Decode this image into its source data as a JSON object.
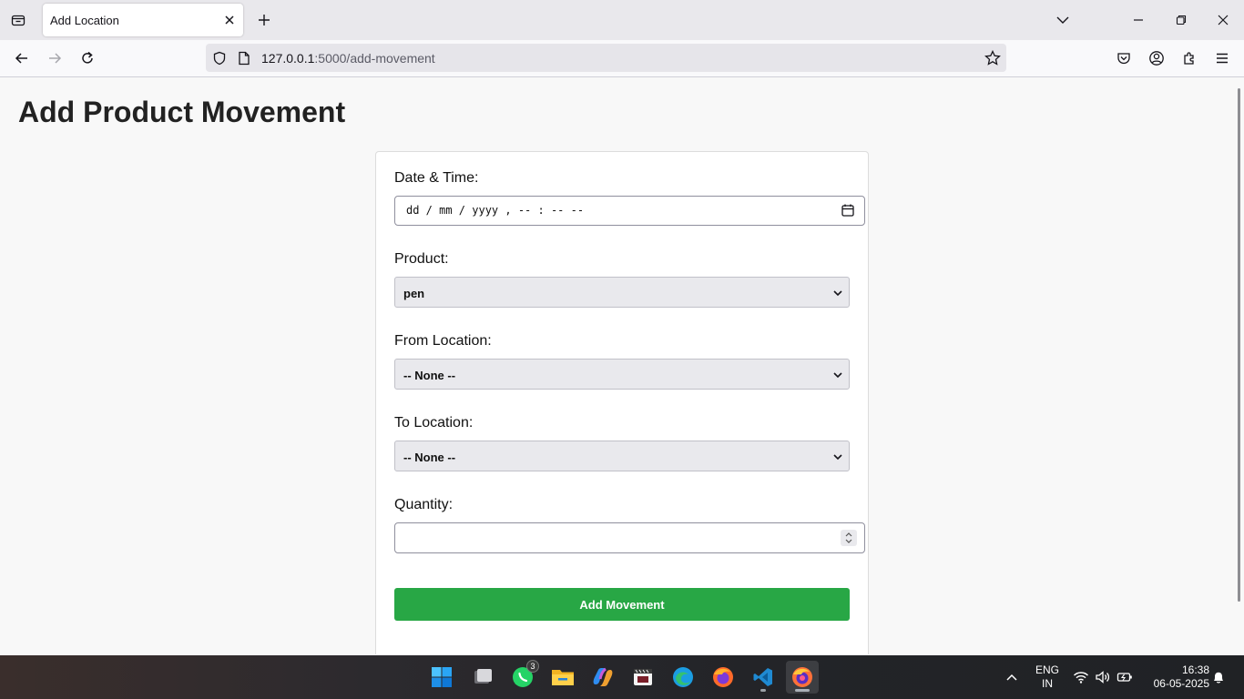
{
  "browser": {
    "tab_title": "Add Location",
    "url_host": "127.0.0.1",
    "url_rest": ":5000/add-movement"
  },
  "page": {
    "heading": "Add Product Movement",
    "form": {
      "datetime_label": "Date & Time:",
      "datetime_placeholder": "dd / mm / yyyy ,  -- : --   --",
      "product_label": "Product:",
      "product_value": "pen",
      "from_label": "From Location:",
      "from_value": "-- None --",
      "to_label": "To Location:",
      "to_value": "-- None --",
      "quantity_label": "Quantity:",
      "quantity_value": "",
      "submit_label": "Add Movement"
    }
  },
  "taskbar": {
    "apps": [
      "start-icon",
      "task-view-icon",
      "whatsapp-icon",
      "file-explorer-icon",
      "copilot-icon",
      "media-player-icon",
      "edge-icon",
      "firefox-icon",
      "vscode-icon",
      "firefox-developer-icon"
    ],
    "whatsapp_badge": "3",
    "lang_top": "ENG",
    "lang_bottom": "IN",
    "time": "16:38",
    "date": "06-05-2025"
  },
  "colors": {
    "accent_green": "#28a745",
    "tab_strip": "#e9e8ec"
  }
}
